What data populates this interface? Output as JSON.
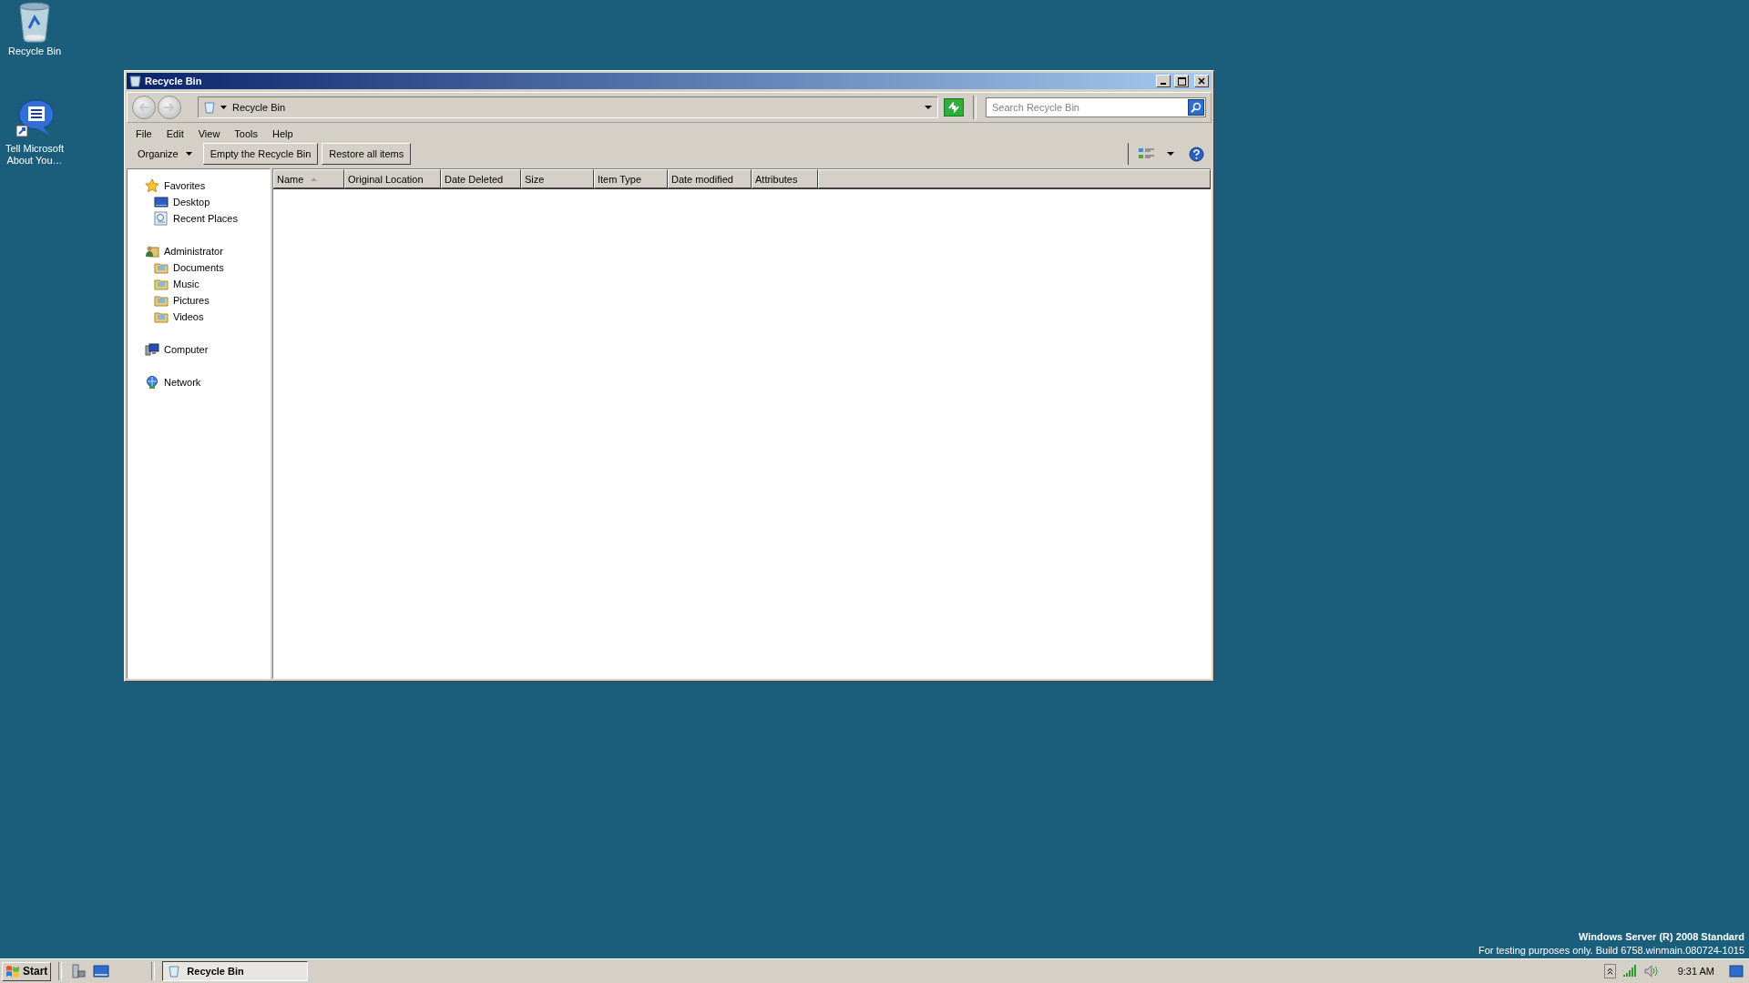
{
  "desktop_icons": [
    {
      "kind": "recycle",
      "label": "Recycle Bin"
    },
    {
      "kind": "feedback",
      "label": "Tell Microsoft About You…"
    }
  ],
  "window": {
    "title": "Recycle Bin",
    "address": "Recycle Bin",
    "search": {
      "placeholder": "Search Recycle Bin"
    },
    "menu": [
      "File",
      "Edit",
      "View",
      "Tools",
      "Help"
    ],
    "toolbar": {
      "organize": "Organize",
      "buttons": [
        "Empty the Recycle Bin",
        "Restore all items"
      ]
    },
    "sidebar": [
      {
        "kind": "star",
        "label": "Favorites",
        "children": [
          {
            "kind": "desktop",
            "label": "Desktop"
          },
          {
            "kind": "recent",
            "label": "Recent Places"
          }
        ]
      },
      {
        "kind": "user",
        "label": "Administrator",
        "children": [
          {
            "kind": "folder",
            "label": "Documents"
          },
          {
            "kind": "folder",
            "label": "Music"
          },
          {
            "kind": "folder",
            "label": "Pictures"
          },
          {
            "kind": "folder",
            "label": "Videos"
          }
        ]
      },
      {
        "kind": "computer",
        "label": "Computer"
      },
      {
        "kind": "network",
        "label": "Network"
      }
    ],
    "columns": [
      {
        "label": "Name",
        "sorted": true
      },
      {
        "label": "Original Location",
        "sorted": false
      },
      {
        "label": "Date Deleted",
        "sorted": false
      },
      {
        "label": "Size",
        "sorted": false
      },
      {
        "label": "Item Type",
        "sorted": false
      },
      {
        "label": "Date modified",
        "sorted": false
      },
      {
        "label": "Attributes",
        "sorted": false
      }
    ]
  },
  "os_notice": [
    "Windows Server (R) 2008 Standard",
    "For testing purposes only. Build 6758.winmain.080724-1015"
  ],
  "taskbar": {
    "start": "Start",
    "tasks": [
      {
        "label": "Recycle Bin",
        "selected": true
      }
    ],
    "clock": "9:31 AM"
  }
}
